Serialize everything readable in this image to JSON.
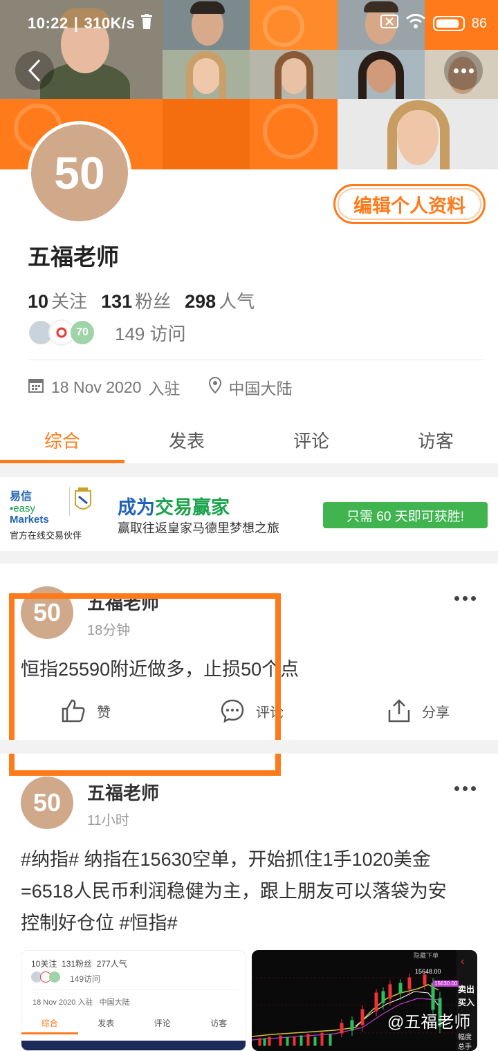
{
  "status_bar": {
    "time": "10:22",
    "speed": "310K/s",
    "battery": "86"
  },
  "profile": {
    "avatar_text": "50",
    "name": "五福老师",
    "edit_label": "编辑个人资料",
    "stats": [
      {
        "value": "10",
        "label": "关注"
      },
      {
        "value": "131",
        "label": "粉丝"
      },
      {
        "value": "298",
        "label": "人气"
      }
    ],
    "visitor_avatar_level": "70",
    "visits": "149",
    "visits_label": "访问",
    "joined_date": "18 Nov 2020",
    "joined_label": "入驻",
    "location": "中国大陆"
  },
  "tabs": [
    "综合",
    "发表",
    "评论",
    "访客"
  ],
  "ad": {
    "logo_cn": "易信",
    "logo_easy": "easy",
    "logo_markets": "Markets",
    "logo_caption": "官方在线交易伙伴",
    "headline_a": "成为",
    "headline_b": "交易赢家",
    "subline": "赢取往返皇家马德里梦想之旅",
    "cta": "只需 60 天即可获胜!"
  },
  "posts": [
    {
      "avatar_text": "50",
      "author": "五福老师",
      "time": "18分钟",
      "text": "恒指25590附近做多，止损50个点",
      "like_label": "赞",
      "comment_label": "评论",
      "share_label": "分享"
    },
    {
      "avatar_text": "50",
      "author": "五福老师",
      "time": "11小时",
      "text_lines": [
        "#纳指# 纳指在15630空单，开始抓住1手1020美金",
        "=6518人民币利润稳健为主，跟上朋友可以落袋为安",
        "控制好仓位 #恒指#"
      ]
    }
  ],
  "thumb_left": {
    "stats": "10关注  131粉丝  277人气",
    "visits": "149访问",
    "meta": "18 Nov 2020 入驻   中国大陆",
    "tabs": [
      "综合",
      "发表",
      "评论",
      "访客"
    ]
  },
  "thumb_right": {
    "top_label": "隐藏下单",
    "price_high": "15648.00",
    "price_now": "15630.00",
    "btn_sell": "卖出",
    "btn_buy": "买入",
    "side_1": "幅度",
    "side_2": "总手"
  },
  "watermark": "@五福老师"
}
